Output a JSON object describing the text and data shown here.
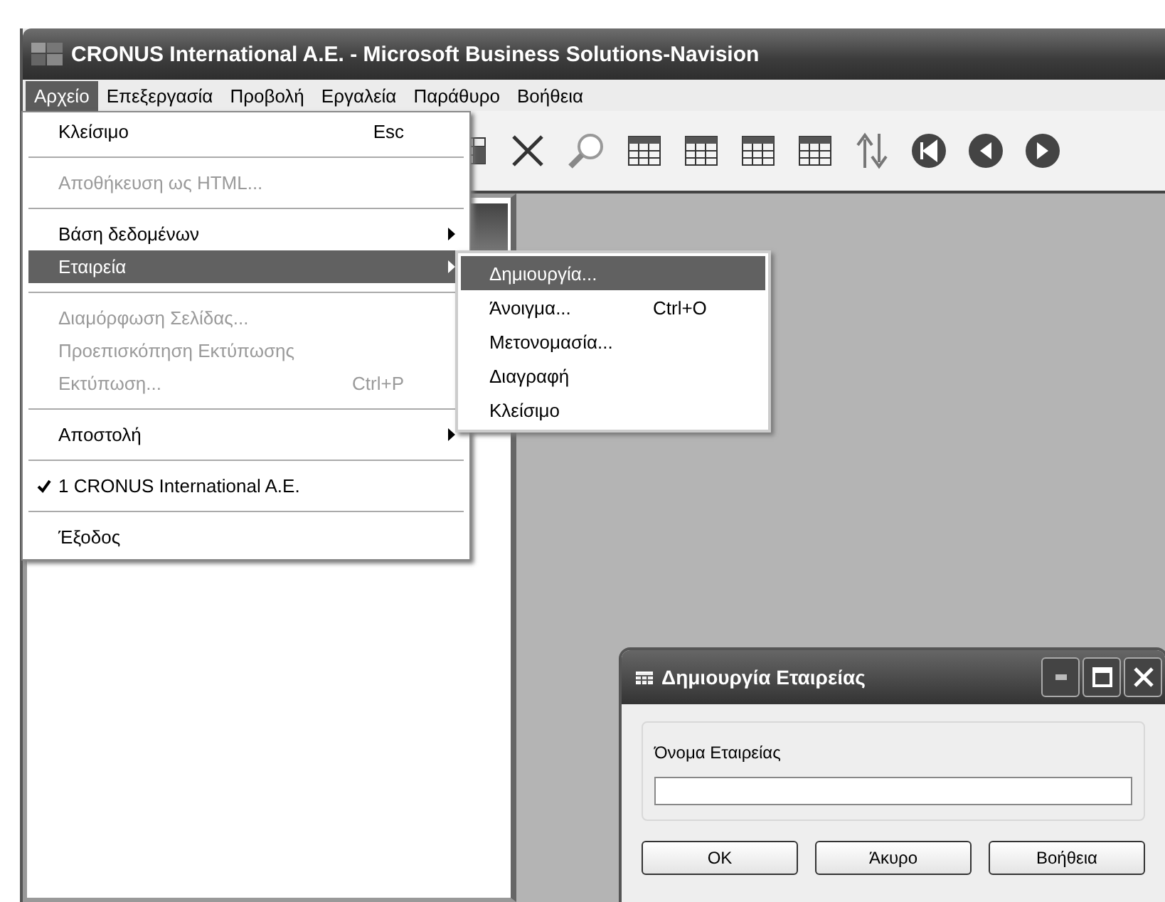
{
  "window": {
    "title": "CRONUS International A.E. - Microsoft Business Solutions-Navision"
  },
  "menu_bar": [
    {
      "label": "Αρχείο",
      "selected": true
    },
    {
      "label": "Επεξεργασία",
      "selected": false
    },
    {
      "label": "Προβολή",
      "selected": false
    },
    {
      "label": "Εργαλεία",
      "selected": false
    },
    {
      "label": "Παράθυρο",
      "selected": false
    },
    {
      "label": "Βοήθεια",
      "selected": false
    }
  ],
  "file_menu": [
    {
      "kind": "item",
      "label": "Κλείσιμο",
      "shortcut": "Esc",
      "disabled": false,
      "submenu": false,
      "checked": false,
      "selected": false
    },
    {
      "kind": "separator"
    },
    {
      "kind": "item",
      "label": "Αποθήκευση ως HTML...",
      "disabled": true,
      "submenu": false,
      "checked": false,
      "selected": false
    },
    {
      "kind": "separator"
    },
    {
      "kind": "item",
      "label": "Βάση δεδομένων",
      "disabled": false,
      "submenu": true,
      "checked": false,
      "selected": false
    },
    {
      "kind": "item",
      "label": "Εταιρεία",
      "disabled": false,
      "submenu": true,
      "checked": false,
      "selected": true
    },
    {
      "kind": "separator"
    },
    {
      "kind": "item",
      "label": "Διαμόρφωση Σελίδας...",
      "disabled": true,
      "submenu": false,
      "checked": false,
      "selected": false
    },
    {
      "kind": "item",
      "label": "Προεπισκόπηση Εκτύπωσης",
      "disabled": true,
      "submenu": false,
      "checked": false,
      "selected": false
    },
    {
      "kind": "item",
      "label": "Εκτύπωση...",
      "shortcut": "Ctrl+P",
      "disabled": true,
      "submenu": false,
      "checked": false,
      "selected": false
    },
    {
      "kind": "separator"
    },
    {
      "kind": "item",
      "label": "Αποστολή",
      "disabled": false,
      "submenu": true,
      "checked": false,
      "selected": false
    },
    {
      "kind": "separator"
    },
    {
      "kind": "item",
      "label": "1 CRONUS International A.E.",
      "disabled": false,
      "submenu": false,
      "checked": true,
      "selected": false
    },
    {
      "kind": "separator"
    },
    {
      "kind": "item",
      "label": "Έξοδος",
      "disabled": false,
      "submenu": false,
      "checked": false,
      "selected": false
    }
  ],
  "company_submenu": [
    {
      "label": "Δημιουργία...",
      "selected": true
    },
    {
      "label": "Άνοιγμα...",
      "shortcut": "Ctrl+O",
      "selected": false
    },
    {
      "label": "Μετονομασία...",
      "selected": false
    },
    {
      "label": "Διαγραφή",
      "selected": false
    },
    {
      "label": "Κλείσιμο",
      "selected": false
    }
  ],
  "dialog": {
    "title": "Δημιουργία Εταιρείας",
    "field_label": "Όνομα Εταιρείας",
    "buttons": [
      "OK",
      "Άκυρο",
      "Βοήθεια"
    ]
  }
}
